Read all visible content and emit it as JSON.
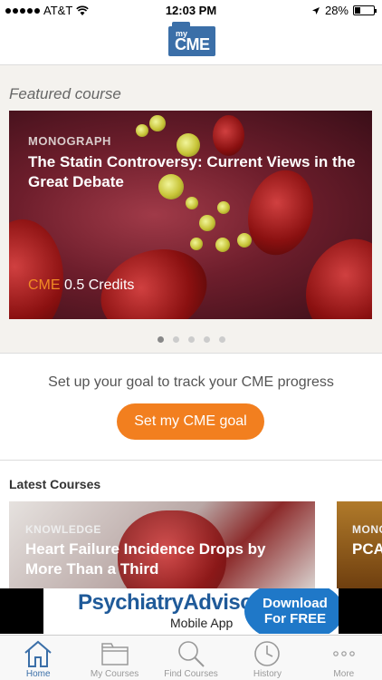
{
  "status_bar": {
    "carrier": "AT&T",
    "time": "12:03 PM",
    "battery": "28%",
    "battery_level": 0.28
  },
  "header": {
    "logo_my": "my",
    "logo_cme": "CME"
  },
  "featured": {
    "section_title": "Featured course",
    "course_type": "MONOGRAPH",
    "course_title": "The Statin Controversy: Current Views in the Great Debate",
    "credits_prefix": "CME",
    "credits_value": "0.5 Credits",
    "carousel_pages": 5,
    "carousel_active": 1
  },
  "goal": {
    "prompt": "Set up your goal to track your CME progress",
    "button_label": "Set my CME goal",
    "button_color": "#f27f1f"
  },
  "latest": {
    "section_title": "Latest Courses",
    "cards": [
      {
        "type": "KNOWLEDGE",
        "title": "Heart Failure Incidence Drops by More Than a Third"
      },
      {
        "type": "MONO",
        "title": "PCA Can"
      }
    ]
  },
  "ad": {
    "brand": "PsychiatryAdvisor",
    "subtitle": "Mobile App",
    "cta": "Download For FREE"
  },
  "tabs": [
    {
      "label": "Home",
      "icon": "home-icon",
      "active": true
    },
    {
      "label": "My Courses",
      "icon": "folder-icon",
      "active": false
    },
    {
      "label": "Find Courses",
      "icon": "search-icon",
      "active": false
    },
    {
      "label": "History",
      "icon": "clock-icon",
      "active": false
    },
    {
      "label": "More",
      "icon": "more-icon",
      "active": false
    }
  ],
  "colors": {
    "accent_blue": "#3b6fa8",
    "accent_orange": "#f27f1f"
  }
}
